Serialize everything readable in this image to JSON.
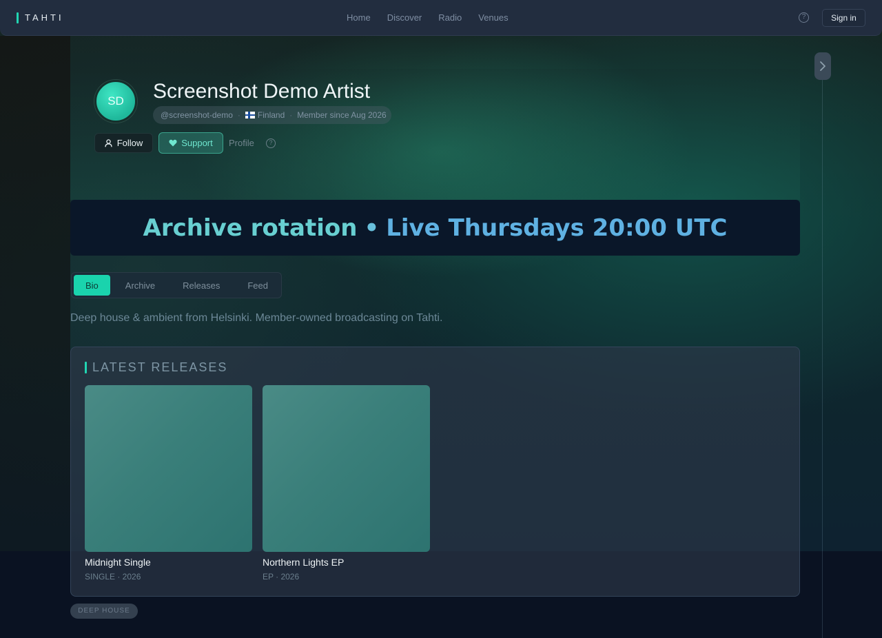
{
  "brand": {
    "name": "TAHTI"
  },
  "nav": {
    "items": [
      "Home",
      "Discover",
      "Radio",
      "Venues"
    ]
  },
  "topbar": {
    "signin_label": "Sign in",
    "help_icon": "question-circle-icon"
  },
  "artist": {
    "initials": "SD",
    "name": "Screenshot Demo Artist",
    "handle": "@screenshot-demo",
    "country": "Finland",
    "member_since": "Member since Aug 2026"
  },
  "actions": {
    "follow_label": "Follow",
    "support_label": "Support",
    "profile_label": "Profile"
  },
  "banner": {
    "part1": "Archive rotation",
    "separator": "•",
    "part2": "Live Thursdays 20:00 UTC"
  },
  "tabs": [
    {
      "label": "Bio",
      "active": true
    },
    {
      "label": "Archive",
      "active": false
    },
    {
      "label": "Releases",
      "active": false
    },
    {
      "label": "Feed",
      "active": false
    }
  ],
  "bio": {
    "text": "Deep house & ambient from Helsinki. Member-owned broadcasting on Tahti."
  },
  "releases": {
    "heading": "LATEST RELEASES",
    "items": [
      {
        "title": "Midnight Single",
        "subtitle": "SINGLE · 2026"
      },
      {
        "title": "Northern Lights EP",
        "subtitle": "EP · 2026"
      }
    ]
  },
  "genre": {
    "tag": "DEEP HOUSE"
  },
  "colors": {
    "accent": "#1ad3ad",
    "banner_text_1": "#68cfd1",
    "banner_text_2": "#5fb1e2",
    "topbar_bg": "#222d3f"
  }
}
